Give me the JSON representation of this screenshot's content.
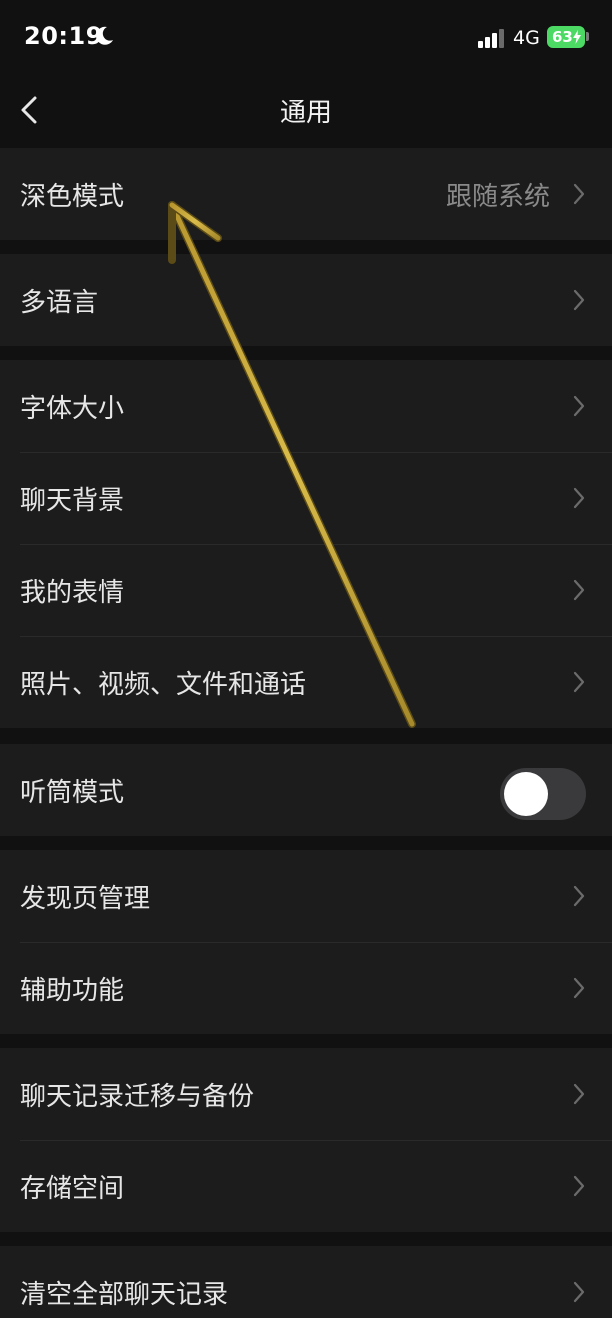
{
  "status_bar": {
    "time": "20:19",
    "network": "4G",
    "battery": "63",
    "icons": [
      "moon-icon",
      "signal-icon",
      "battery-icon",
      "charging-bolt-icon"
    ]
  },
  "nav": {
    "title": "通用",
    "back_icon": "chevron-left-icon"
  },
  "groups": [
    {
      "rows": [
        {
          "label": "深色模式",
          "value": "跟随系统",
          "control": "chevron"
        }
      ]
    },
    {
      "rows": [
        {
          "label": "多语言",
          "control": "chevron"
        }
      ]
    },
    {
      "rows": [
        {
          "label": "字体大小",
          "control": "chevron"
        },
        {
          "label": "聊天背景",
          "control": "chevron"
        },
        {
          "label": "我的表情",
          "control": "chevron"
        },
        {
          "label": "照片、视频、文件和通话",
          "control": "chevron"
        }
      ]
    },
    {
      "rows": [
        {
          "label": "听筒模式",
          "control": "toggle",
          "toggle_on": false
        }
      ]
    },
    {
      "rows": [
        {
          "label": "发现页管理",
          "control": "chevron"
        },
        {
          "label": "辅助功能",
          "control": "chevron"
        }
      ]
    },
    {
      "rows": [
        {
          "label": "聊天记录迁移与备份",
          "control": "chevron"
        },
        {
          "label": "存储空间",
          "control": "chevron"
        }
      ]
    },
    {
      "rows": [
        {
          "label": "清空全部聊天记录",
          "control": "chevron"
        }
      ]
    }
  ],
  "colors": {
    "background": "#111111",
    "row_background": "#1c1c1c",
    "text": "#e6e6e6",
    "secondary_text": "#8a8a8a",
    "battery": "#4cd964",
    "annotation_arrow": "#c9a93a"
  }
}
